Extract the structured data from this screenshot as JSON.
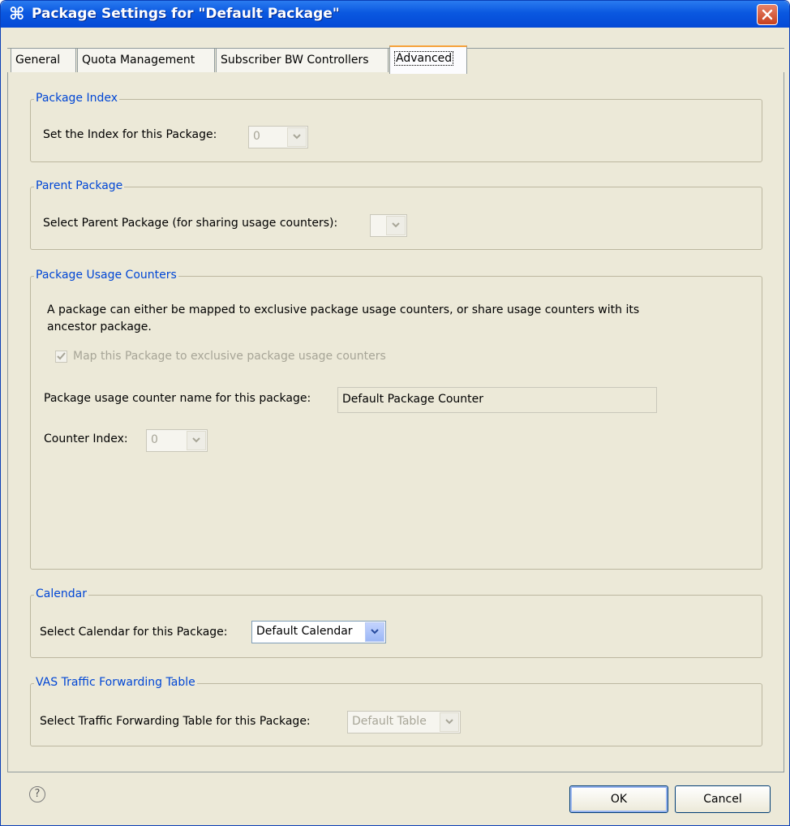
{
  "window": {
    "title": "Package Settings for \"Default Package\"",
    "title_icon": "⌘"
  },
  "tabs": [
    {
      "label": "General",
      "active": false
    },
    {
      "label": "Quota Management",
      "active": false
    },
    {
      "label": "Subscriber BW Controllers",
      "active": false
    },
    {
      "label": "Advanced",
      "active": true
    }
  ],
  "package_index": {
    "legend": "Package Index",
    "label": "Set the Index for this Package:",
    "value": "0"
  },
  "parent_package": {
    "legend": "Parent Package",
    "label": "Select Parent Package (for sharing usage counters):",
    "value": ""
  },
  "usage_counters": {
    "legend": "Package Usage Counters",
    "description_line1": "A package can either be mapped to exclusive package usage counters, or share usage counters with its",
    "description_line2": "ancestor package.",
    "checkbox_label": "Map this Package to exclusive package usage counters",
    "checkbox_checked": true,
    "counter_name_label": "Package usage counter name for this package:",
    "counter_name_value": "Default Package Counter",
    "counter_index_label": "Counter Index:",
    "counter_index_value": "0"
  },
  "calendar": {
    "legend": "Calendar",
    "label": "Select Calendar for this Package:",
    "value": "Default Calendar"
  },
  "vas": {
    "legend": "VAS Traffic Forwarding Table",
    "label": "Select Traffic Forwarding Table for this Package:",
    "value": "Default Table"
  },
  "footer": {
    "help_glyph": "?",
    "ok_label": "OK",
    "cancel_label": "Cancel"
  },
  "colors": {
    "legend_text": "#0046d5",
    "title_bar": "#0a58e0",
    "dialog_bg": "#ece9d8"
  }
}
